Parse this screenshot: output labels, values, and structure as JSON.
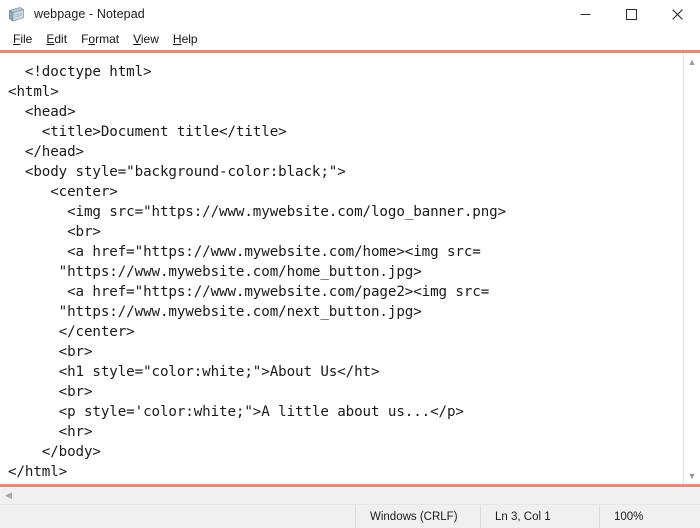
{
  "window": {
    "title": "webpage - Notepad",
    "icon": "notepad-icon"
  },
  "caption": {
    "minimize": "minimize-icon",
    "maximize": "maximize-icon",
    "close": "close-icon"
  },
  "menu": {
    "items": [
      {
        "label": "File",
        "accel": "F"
      },
      {
        "label": "Edit",
        "accel": "E"
      },
      {
        "label": "Format",
        "accel": "o"
      },
      {
        "label": "View",
        "accel": "V"
      },
      {
        "label": "Help",
        "accel": "H"
      }
    ]
  },
  "editor": {
    "content": "  <!doctype html>\n<html>\n  <head>\n    <title>Document title</title>\n  </head>\n  <body style=\"background-color:black;\">\n     <center>\n       <img src=\"https://www.mywebsite.com/logo_banner.png>\n       <br>\n       <a href=\"https://www.mywebsite.com/home><img src=\n      \"https://www.mywebsite.com/home_button.jpg>\n       <a href=\"https://www.mywebsite.com/page2><img src=\n      \"https://www.mywebsite.com/next_button.jpg>\n      </center>\n      <br>\n      <h1 style=\"color:white;\">About Us</ht>\n      <br>\n      <p style='color:white;\">A little about us...</p>\n      <hr>\n    </body>\n</html>"
  },
  "scrollbars": {
    "v_up": "scroll-up-arrow",
    "v_down": "scroll-down-arrow",
    "h_left": "scroll-left-arrow"
  },
  "statusbar": {
    "line_ending": "Windows (CRLF)",
    "cursor_position": "Ln 3, Col 1",
    "zoom": "100%"
  },
  "colors": {
    "accent_rule": "#e8897a",
    "statusbar_bg": "#f0f0f0",
    "text": "#1a1a1a"
  }
}
